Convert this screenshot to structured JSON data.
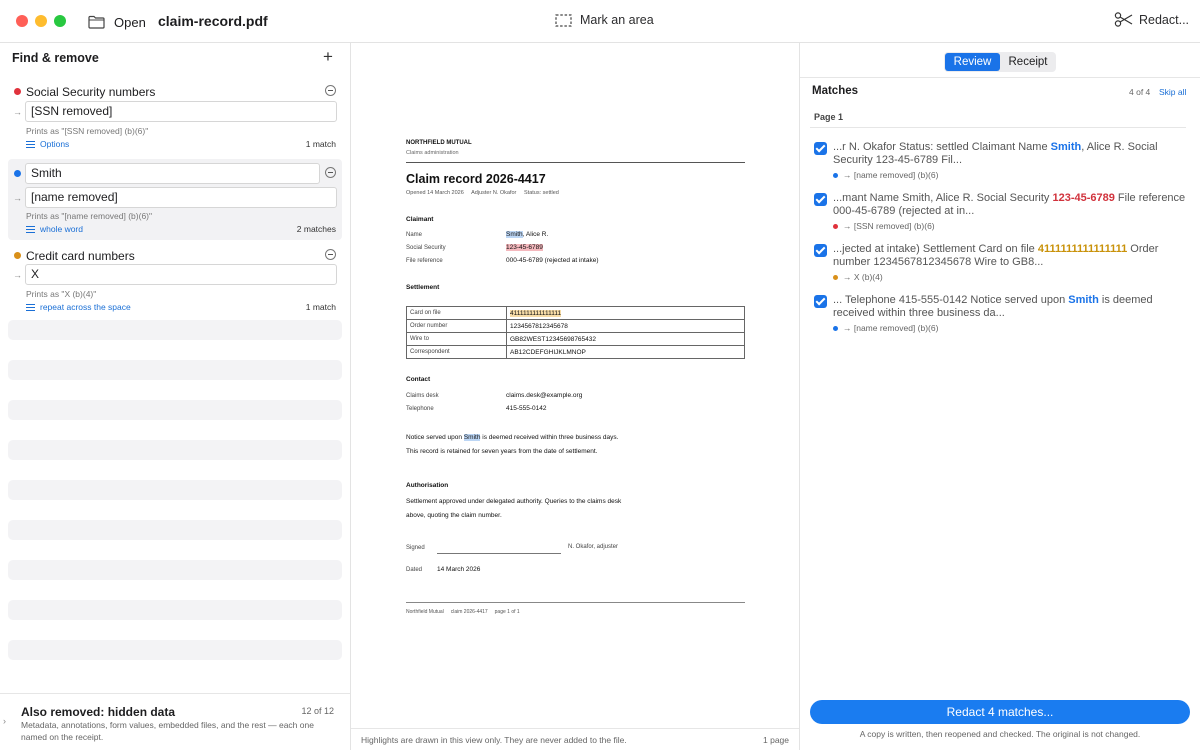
{
  "titlebar": {
    "open_label": "Open",
    "filename": "claim-record.pdf",
    "mark_area_label": "Mark an area",
    "redact_label": "Redact..."
  },
  "left": {
    "heading": "Find & remove",
    "rules": [
      {
        "name": "Social Security numbers",
        "color": "#e0323c",
        "replacement": "[SSN removed]",
        "prints": "Prints as \"[SSN removed] (b)(6)\"",
        "option": "Options",
        "count": "1 match"
      },
      {
        "name": "Smith",
        "color": "#1a73e8",
        "replacement": "[name removed]",
        "prints": "Prints as \"[name removed] (b)(6)\"",
        "option": "whole word",
        "count": "2 matches"
      },
      {
        "name": "Credit card numbers",
        "color": "#d9901a",
        "replacement": "X",
        "prints": "Prints as \"X (b)(4)\"",
        "option": "repeat across the space",
        "count": "1 match"
      }
    ],
    "footer": {
      "title": "Also removed: hidden data",
      "count": "12 of 12",
      "desc": "Metadata, annotations, form values, embedded files, and the rest — each one named on the receipt."
    }
  },
  "doc": {
    "org": "NORTHFIELD MUTUAL",
    "org_sub": "Claims administration",
    "title": "Claim record 2026-4417",
    "meta": "Opened 14 March 2026     Adjuster N. Okafor     Status: settled",
    "claimant_h": "Claimant",
    "claimant": {
      "name_k": "Name",
      "name_hl": "Smith",
      "name_rest": ", Alice R.",
      "ssn_k": "Social Security",
      "ssn_v": "123-45-6789",
      "ref_k": "File reference",
      "ref_v": "000-45-6789 (rejected at intake)"
    },
    "settlement_h": "Settlement",
    "settlement": [
      {
        "k": "Card on file",
        "v": "4111111111111111"
      },
      {
        "k": "Order number",
        "v": "1234567812345678"
      },
      {
        "k": "Wire to",
        "v": "GB82WEST12345698765432"
      },
      {
        "k": "Correspondent",
        "v": "AB12CDEFGHIJKLMNOP"
      }
    ],
    "contact_h": "Contact",
    "contact": {
      "desk_k": "Claims desk",
      "desk_v": "claims.desk@example.org",
      "tel_k": "Telephone",
      "tel_v": "415-555-0142"
    },
    "notice_a": "Notice served upon ",
    "notice_hl": "Smith",
    "notice_b": " is deemed received within three business days.",
    "retain": "This record is retained for seven years from the date of settlement.",
    "auth_h": "Authorisation",
    "auth_1": "Settlement approved under delegated authority. Queries to the claims desk",
    "auth_2": "above, quoting the claim number.",
    "signed_k": "Signed",
    "signed_v": "N. Okafor, adjuster",
    "dated_k": "Dated",
    "dated_v": "14 March 2026",
    "footer": "Northfield Mutual     claim 2026-4417     page 1 of 1"
  },
  "center_footer": {
    "note": "Highlights are drawn in this view only. They are never added to the file.",
    "pages": "1 page"
  },
  "right": {
    "tab_review": "Review",
    "tab_receipt": "Receipt",
    "heading": "Matches",
    "count": "4 of 4",
    "skip_all": "Skip all",
    "page_label": "Page 1",
    "matches": [
      {
        "pre": "...r N. Okafor Status: settled Claimant Name ",
        "hit": "Smith",
        "kind": "name",
        "post": ", Alice R. Social Security 123-45-6789 Fil...",
        "dot": "#1a73e8",
        "sub": "→ [name removed] (b)(6)"
      },
      {
        "pre": "...mant Name Smith, Alice R. Social Security ",
        "hit": "123-45-6789",
        "kind": "ssn",
        "post": " File reference 000-45-6789 (rejected at in...",
        "dot": "#e0323c",
        "sub": "→ [SSN removed] (b)(6)"
      },
      {
        "pre": "...jected at intake) Settlement Card on file ",
        "hit": "4111111111111111",
        "kind": "card",
        "post": " Order number 1234567812345678 Wire to GB8...",
        "dot": "#d9901a",
        "sub": "→ X (b)(4)"
      },
      {
        "pre": "... Telephone 415-555-0142 Notice served upon ",
        "hit": "Smith",
        "kind": "name",
        "post": " is deemed received within three business da...",
        "dot": "#1a73e8",
        "sub": "→ [name removed] (b)(6)"
      }
    ],
    "redact_button": "Redact 4 matches...",
    "footer": "A copy is written, then reopened and checked. The original is not changed."
  }
}
